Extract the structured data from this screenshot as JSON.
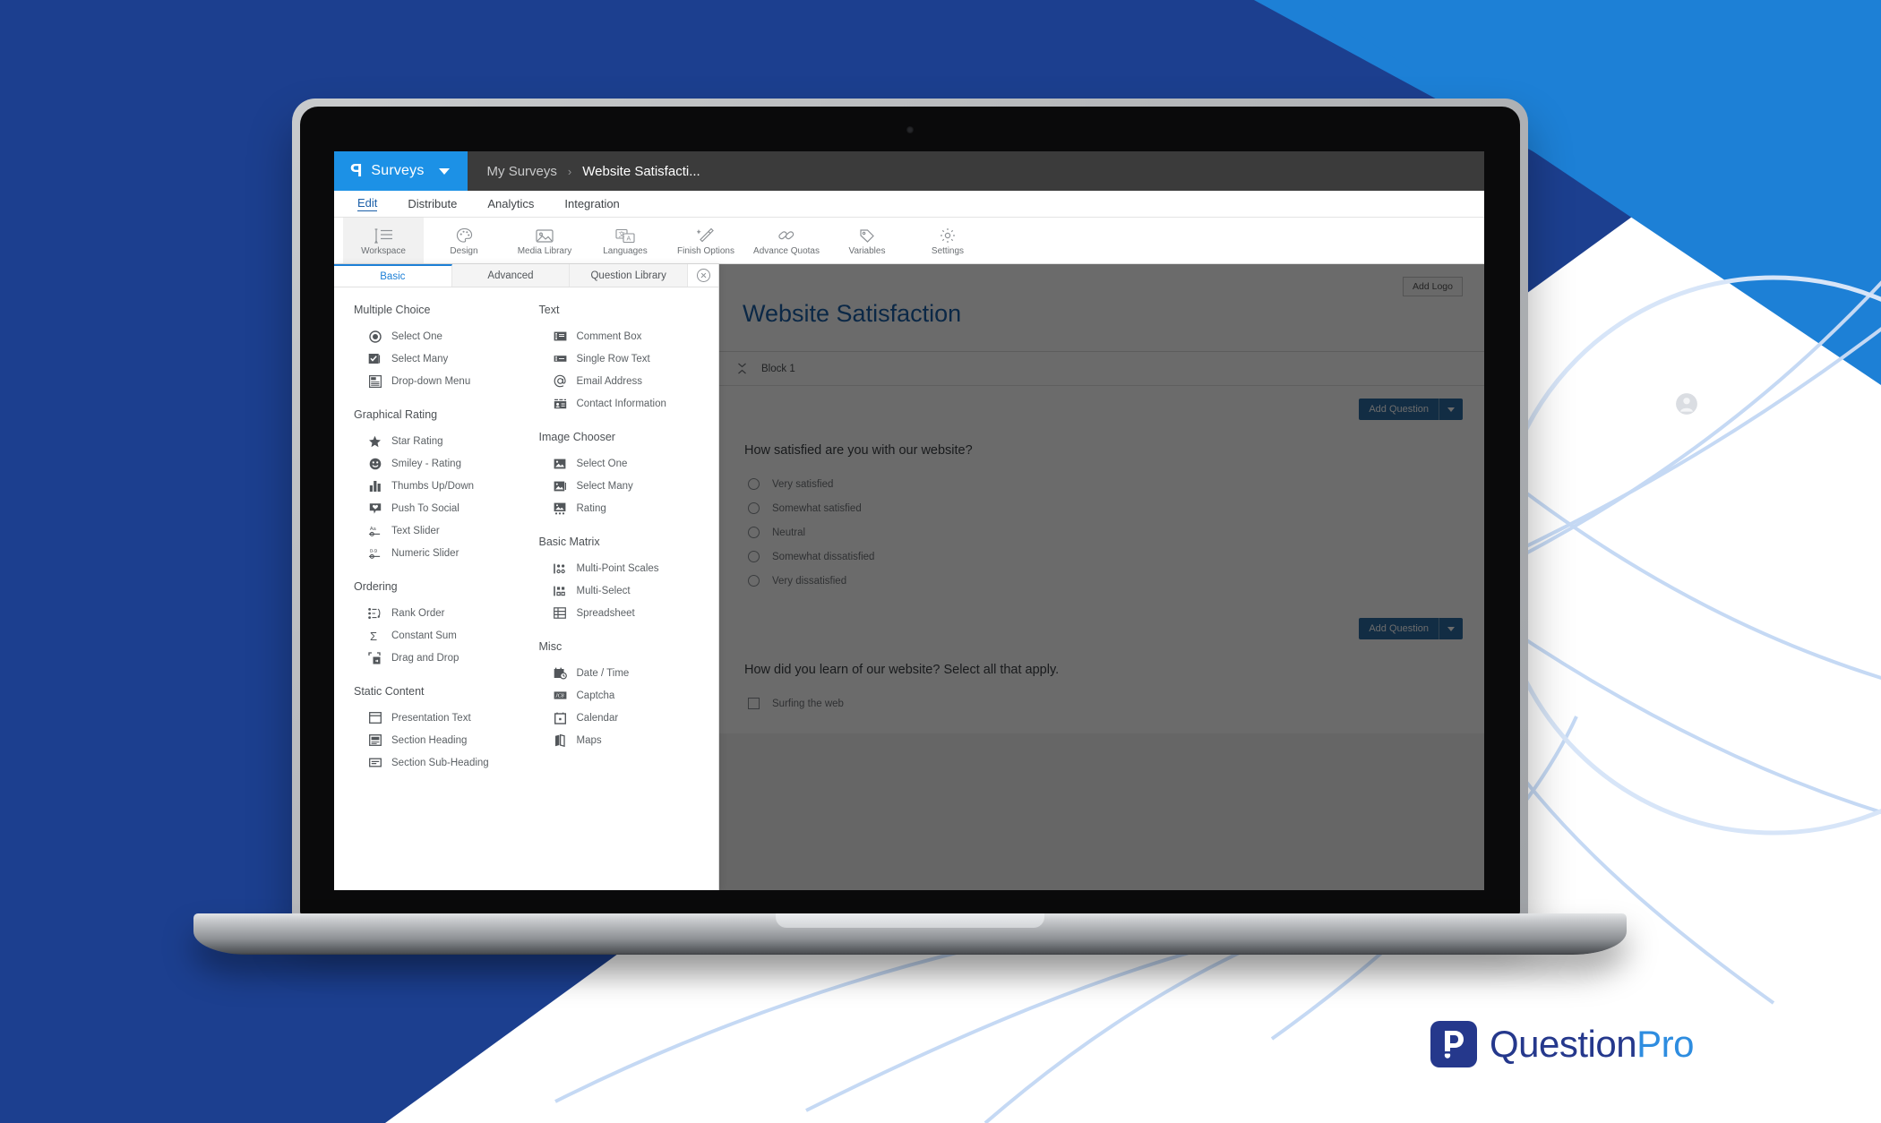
{
  "colors": {
    "bg_navy": "#1c3f8f",
    "bg_blue": "#1d80d6",
    "brand_blue": "#1c91e6",
    "title_blue": "#1b5fa8",
    "logo_dark": "#25388c",
    "logo_light": "#2e8de0",
    "topbar_dark": "#3b3b3b",
    "addq_blue": "#2d6ca2"
  },
  "topbar": {
    "brand_logo_icon": "questionpro-p-icon",
    "brand_label": "Surveys",
    "brand_caret_icon": "chevron-down-icon",
    "breadcrumb_root": "My Surveys",
    "breadcrumb_separator": "›",
    "breadcrumb_current": "Website Satisfacti..."
  },
  "menubar": {
    "items": [
      {
        "label": "Edit",
        "active": true
      },
      {
        "label": "Distribute",
        "active": false
      },
      {
        "label": "Analytics",
        "active": false
      },
      {
        "label": "Integration",
        "active": false
      }
    ]
  },
  "ribbon": {
    "items": [
      {
        "label": "Workspace",
        "icon": "workspace-icon",
        "selected": true
      },
      {
        "label": "Design",
        "icon": "palette-icon",
        "selected": false
      },
      {
        "label": "Media Library",
        "icon": "image-icon",
        "selected": false
      },
      {
        "label": "Languages",
        "icon": "translate-icon",
        "selected": false
      },
      {
        "label": "Finish Options",
        "icon": "magic-wand-icon",
        "selected": false
      },
      {
        "label": "Advance Quotas",
        "icon": "link-icon",
        "selected": false
      },
      {
        "label": "Variables",
        "icon": "tag-icon",
        "selected": false
      },
      {
        "label": "Settings",
        "icon": "gear-icon",
        "selected": false
      }
    ]
  },
  "panel": {
    "tabs": [
      {
        "label": "Basic",
        "active": true
      },
      {
        "label": "Advanced",
        "active": false
      },
      {
        "label": "Question Library",
        "active": false
      }
    ],
    "close_icon": "close-circle-icon",
    "left_groups": [
      {
        "title": "Multiple Choice",
        "items": [
          {
            "label": "Select One",
            "icon": "radio-button-icon"
          },
          {
            "label": "Select Many",
            "icon": "checkbox-icon"
          },
          {
            "label": "Drop-down Menu",
            "icon": "dropdown-list-icon"
          }
        ]
      },
      {
        "title": "Graphical Rating",
        "items": [
          {
            "label": "Star Rating",
            "icon": "star-icon"
          },
          {
            "label": "Smiley - Rating",
            "icon": "smiley-icon"
          },
          {
            "label": "Thumbs Up/Down",
            "icon": "bar-chart-icon"
          },
          {
            "label": "Push To Social",
            "icon": "heart-speech-bubble-icon"
          },
          {
            "label": "Text Slider",
            "icon": "text-slider-icon"
          },
          {
            "label": "Numeric Slider",
            "icon": "numeric-slider-icon"
          }
        ]
      },
      {
        "title": "Ordering",
        "items": [
          {
            "label": "Rank Order",
            "icon": "rank-order-icon"
          },
          {
            "label": "Constant Sum",
            "icon": "sigma-icon"
          },
          {
            "label": "Drag and Drop",
            "icon": "drag-drop-icon"
          }
        ]
      },
      {
        "title": "Static Content",
        "items": [
          {
            "label": "Presentation Text",
            "icon": "presentation-text-icon"
          },
          {
            "label": "Section Heading",
            "icon": "section-heading-icon"
          },
          {
            "label": "Section Sub-Heading",
            "icon": "section-subheading-icon"
          }
        ]
      }
    ],
    "right_groups": [
      {
        "title": "Text",
        "items": [
          {
            "label": "Comment Box",
            "icon": "comment-box-icon"
          },
          {
            "label": "Single Row Text",
            "icon": "single-row-text-icon"
          },
          {
            "label": "Email Address",
            "icon": "at-sign-icon"
          },
          {
            "label": "Contact Information",
            "icon": "contact-card-icon"
          }
        ]
      },
      {
        "title": "Image Chooser",
        "items": [
          {
            "label": "Select One",
            "icon": "image-select-one-icon"
          },
          {
            "label": "Select Many",
            "icon": "image-select-many-icon"
          },
          {
            "label": "Rating",
            "icon": "image-rating-icon"
          }
        ]
      },
      {
        "title": "Basic Matrix",
        "items": [
          {
            "label": "Multi-Point Scales",
            "icon": "multi-point-scale-icon"
          },
          {
            "label": "Multi-Select",
            "icon": "multi-select-icon"
          },
          {
            "label": "Spreadsheet",
            "icon": "spreadsheet-icon"
          }
        ]
      },
      {
        "title": "Misc",
        "items": [
          {
            "label": "Date / Time",
            "icon": "date-time-icon"
          },
          {
            "label": "Captcha",
            "icon": "captcha-icon"
          },
          {
            "label": "Calendar",
            "icon": "calendar-icon"
          },
          {
            "label": "Maps",
            "icon": "map-icon"
          }
        ]
      }
    ]
  },
  "survey": {
    "add_logo_label": "Add Logo",
    "title": "Website Satisfaction",
    "block_label": "Block 1",
    "add_question_label": "Add Question",
    "questions": [
      {
        "text": "How satisfied are you with our website?",
        "type": "radio",
        "options": [
          "Very satisfied",
          "Somewhat satisfied",
          "Neutral",
          "Somewhat dissatisfied",
          "Very dissatisfied"
        ]
      },
      {
        "text": "How did you learn of our website? Select all that apply.",
        "type": "checkbox",
        "options": [
          "Surfing the web"
        ]
      }
    ]
  },
  "footer_logo": {
    "mark_icon": "questionpro-p-icon",
    "word_dark": "Question",
    "word_light": "Pro"
  }
}
